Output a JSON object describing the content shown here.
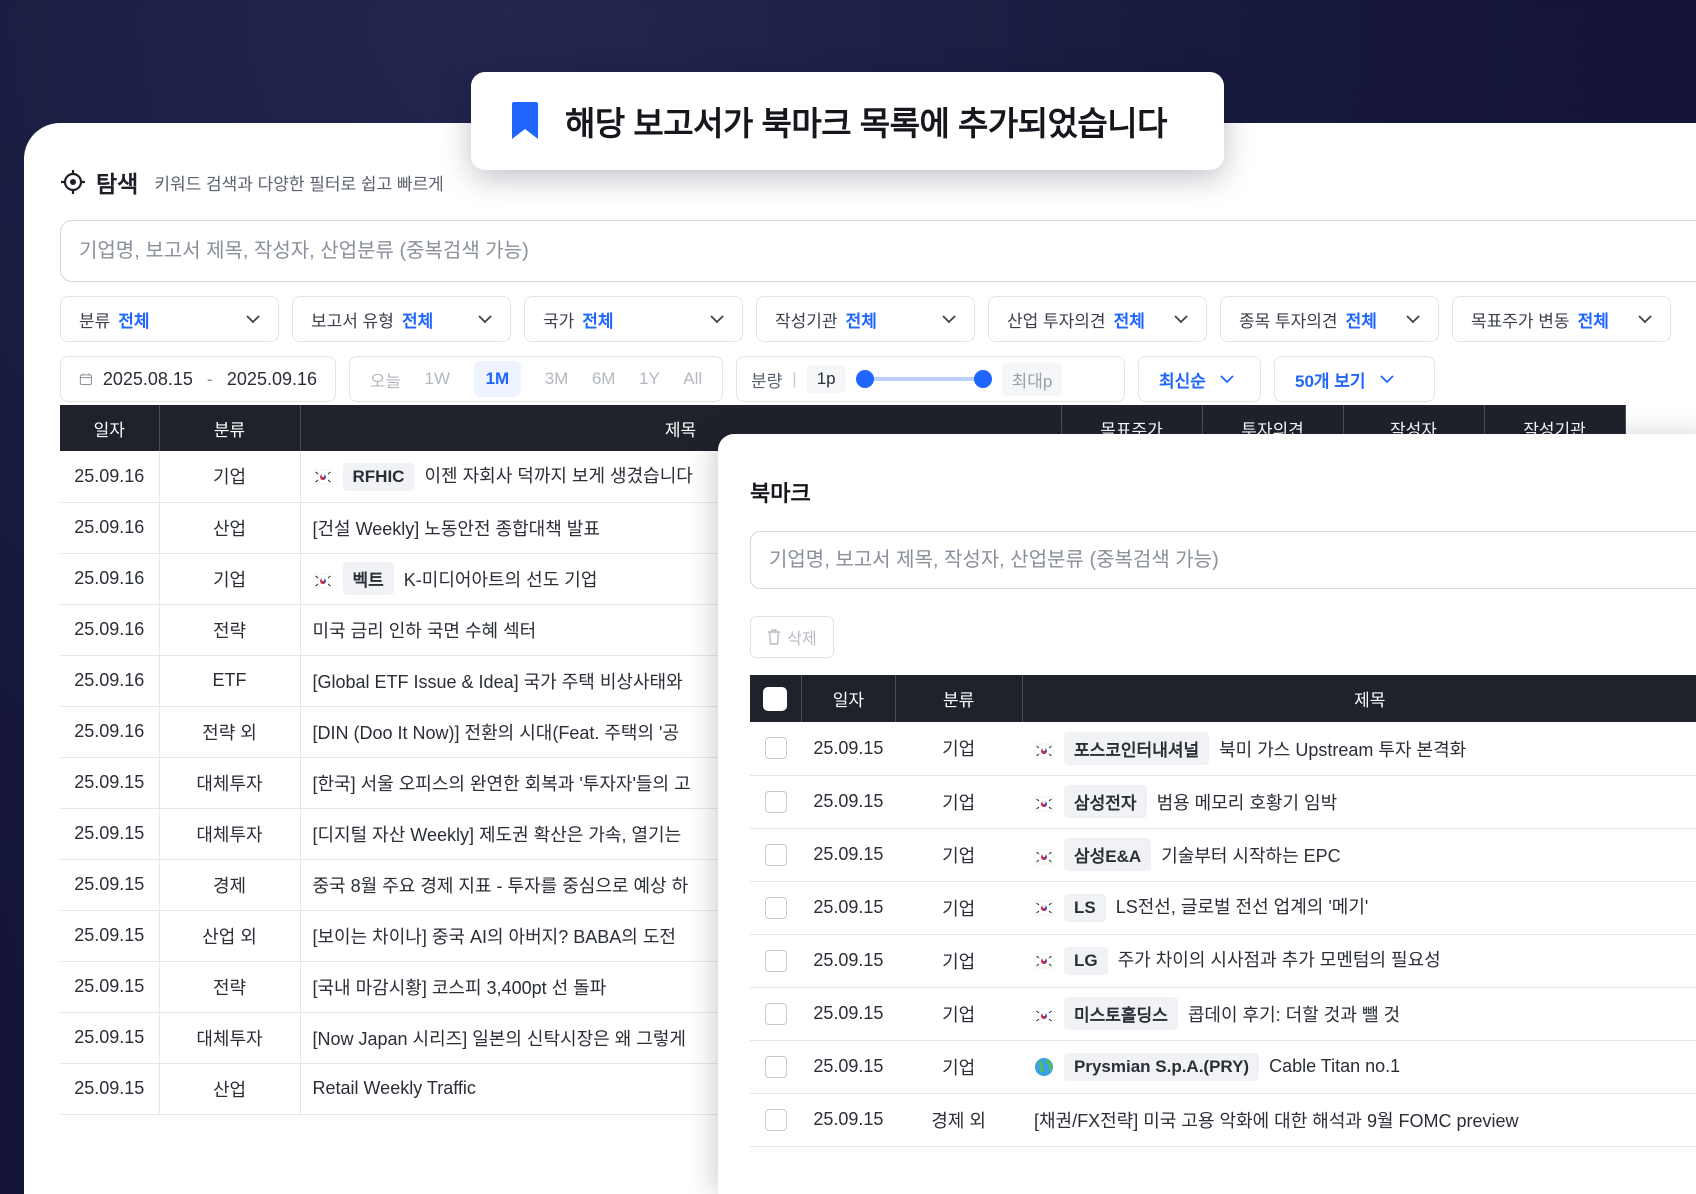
{
  "header": {
    "title": "탐색",
    "subtitle": "키워드 검색과 다양한 필터로 쉽고 빠르게"
  },
  "search": {
    "placeholder": "기업명, 보고서 제목, 작성자, 산업분류 (중복검색 가능)"
  },
  "filters": [
    {
      "label": "분류",
      "value": "전체"
    },
    {
      "label": "보고서 유형",
      "value": "전체"
    },
    {
      "label": "국가",
      "value": "전체"
    },
    {
      "label": "작성기관",
      "value": "전체"
    },
    {
      "label": "산업 투자의견",
      "value": "전체"
    },
    {
      "label": "종목 투자의견",
      "value": "전체"
    },
    {
      "label": "목표주가 변동",
      "value": "전체"
    }
  ],
  "date_range": {
    "start": "2025.08.15",
    "separator": "-",
    "end": "2025.09.16"
  },
  "ranges": [
    "오늘",
    "1W",
    "1M",
    "3M",
    "6M",
    "1Y",
    "All"
  ],
  "active_range": "1M",
  "volume": {
    "label": "분량",
    "min": "1p",
    "max": "최대p"
  },
  "sort": {
    "label": "최신순"
  },
  "page_size": {
    "label": "50개 보기"
  },
  "table": {
    "columns": [
      "일자",
      "분류",
      "제목",
      "목표주가",
      "투자의견",
      "작성자",
      "작성기관"
    ],
    "rows": [
      {
        "date": "25.09.16",
        "category": "기업",
        "flag": "kr",
        "ticker": "RFHIC",
        "title": "이젠 자회사 덕까지 보게 생겼습니다"
      },
      {
        "date": "25.09.16",
        "category": "산업",
        "flag": "",
        "ticker": "",
        "title": "[건설 Weekly] 노동안전 종합대책 발표"
      },
      {
        "date": "25.09.16",
        "category": "기업",
        "flag": "kr",
        "ticker": "벡트",
        "title": "K-미디어아트의 선도 기업"
      },
      {
        "date": "25.09.16",
        "category": "전략",
        "flag": "",
        "ticker": "",
        "title": "미국 금리 인하 국면 수혜 섹터"
      },
      {
        "date": "25.09.16",
        "category": "ETF",
        "flag": "",
        "ticker": "",
        "title": "[Global ETF Issue & Idea] 국가 주택 비상사태와"
      },
      {
        "date": "25.09.16",
        "category": "전략 외",
        "flag": "",
        "ticker": "",
        "title": "[DIN (Doo It Now)] 전환의 시대(Feat. 주택의 '공"
      },
      {
        "date": "25.09.15",
        "category": "대체투자",
        "flag": "",
        "ticker": "",
        "title": "[한국] 서울 오피스의 완연한 회복과 '투자자'들의 고"
      },
      {
        "date": "25.09.15",
        "category": "대체투자",
        "flag": "",
        "ticker": "",
        "title": "[디지털 자산 Weekly] 제도권 확산은 가속, 열기는"
      },
      {
        "date": "25.09.15",
        "category": "경제",
        "flag": "",
        "ticker": "",
        "title": "중국 8월 주요 경제 지표 - 투자를 중심으로 예상 하"
      },
      {
        "date": "25.09.15",
        "category": "산업 외",
        "flag": "",
        "ticker": "",
        "title": "[보이는 차이나] 중국 AI의 아버지? BABA의 도전"
      },
      {
        "date": "25.09.15",
        "category": "전략",
        "flag": "",
        "ticker": "",
        "title": "[국내 마감시황] 코스피 3,400pt 선 돌파"
      },
      {
        "date": "25.09.15",
        "category": "대체투자",
        "flag": "",
        "ticker": "",
        "title": "[Now Japan 시리즈] 일본의 신탁시장은 왜 그렇게"
      },
      {
        "date": "25.09.15",
        "category": "산업",
        "flag": "",
        "ticker": "",
        "title": "Retail Weekly Traffic"
      }
    ]
  },
  "toast": {
    "message": "해당 보고서가 북마크 목록에 추가되었습니다"
  },
  "bookmark": {
    "title": "북마크",
    "search_placeholder": "기업명, 보고서 제목, 작성자, 산업분류 (중복검색 가능)",
    "delete_label": "삭제",
    "columns": [
      "일자",
      "분류",
      "제목"
    ],
    "rows": [
      {
        "date": "25.09.15",
        "category": "기업",
        "flag": "kr",
        "ticker": "포스코인터내셔널",
        "title": "북미 가스 Upstream 투자 본격화"
      },
      {
        "date": "25.09.15",
        "category": "기업",
        "flag": "kr",
        "ticker": "삼성전자",
        "title": "범용 메모리 호황기 임박"
      },
      {
        "date": "25.09.15",
        "category": "기업",
        "flag": "kr",
        "ticker": "삼성E&A",
        "title": "기술부터 시작하는 EPC"
      },
      {
        "date": "25.09.15",
        "category": "기업",
        "flag": "kr",
        "ticker": "LS",
        "title": "LS전선, 글로벌 전선 업계의 '메기'"
      },
      {
        "date": "25.09.15",
        "category": "기업",
        "flag": "kr",
        "ticker": "LG",
        "title": "주가 차이의 시사점과 추가 모멘텀의 필요성"
      },
      {
        "date": "25.09.15",
        "category": "기업",
        "flag": "kr",
        "ticker": "미스토홀딩스",
        "title": "콥데이 후기: 더할 것과 뺄 것"
      },
      {
        "date": "25.09.15",
        "category": "기업",
        "flag": "globe",
        "ticker": "Prysmian S.p.A.(PRY)",
        "title": "Cable Titan no.1"
      },
      {
        "date": "25.09.15",
        "category": "경제 외",
        "flag": "",
        "ticker": "",
        "title": "[채권/FX전략] 미국 고용 악화에 대한 해석과 9월 FOMC preview"
      }
    ]
  },
  "colors": {
    "accent": "#1f66ff",
    "header_dark": "#1f222b",
    "bg_navy": "#15163a"
  }
}
